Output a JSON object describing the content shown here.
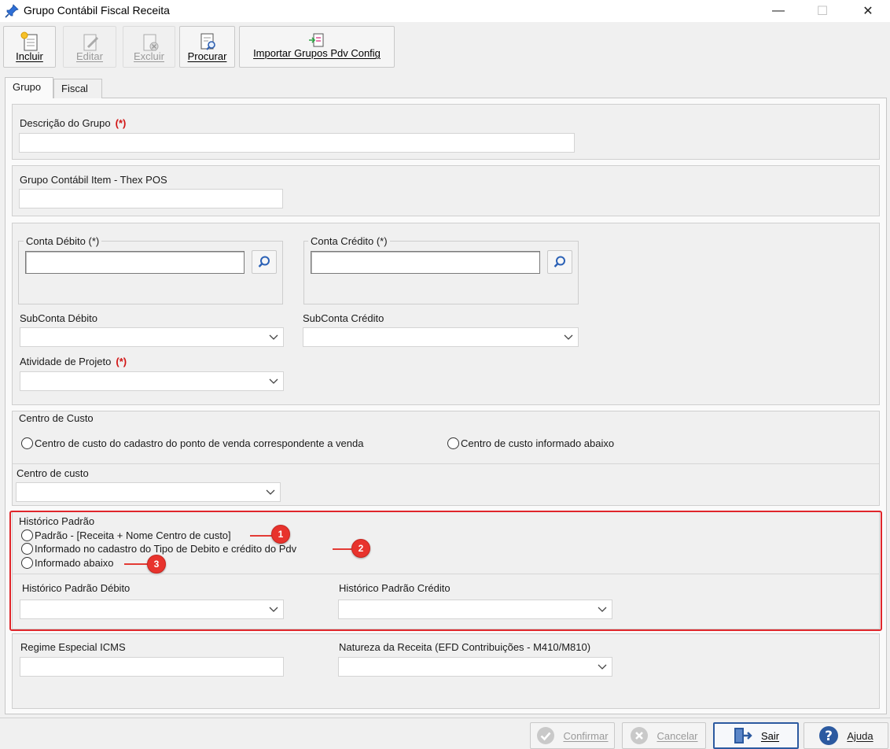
{
  "window": {
    "title": "Grupo Contábil Fiscal Receita",
    "controls": {
      "minimize": "—",
      "maximize": "☐",
      "close": "✕"
    }
  },
  "toolbar": {
    "buttons": [
      {
        "label": "Incluir",
        "icon": "new-document-icon",
        "enabled": true
      },
      {
        "label": "Editar",
        "icon": "edit-document-icon",
        "enabled": false
      },
      {
        "label": "Excluir",
        "icon": "delete-document-icon",
        "enabled": false
      },
      {
        "label": "Procurar",
        "icon": "search-document-icon",
        "enabled": true
      },
      {
        "label": "Importar Grupos Pdv Config",
        "icon": "import-document-icon",
        "enabled": true
      }
    ]
  },
  "tabs": [
    {
      "label": "Grupo",
      "active": true
    },
    {
      "label": "Fiscal",
      "active": false
    }
  ],
  "form": {
    "descricao_grupo": {
      "label": "Descrição do Grupo",
      "required_mark": "(*)",
      "value": ""
    },
    "grupo_contabil_item": {
      "label": "Grupo Contábil Item - Thex POS",
      "value": ""
    },
    "conta_debito": {
      "label": "Conta Débito (*)",
      "value": ""
    },
    "conta_credito": {
      "label": "Conta Crédito (*)",
      "value": ""
    },
    "subconta_debito": {
      "label": "SubConta Débito",
      "value": ""
    },
    "subconta_credito": {
      "label": "SubConta Crédito",
      "value": ""
    },
    "atividade_projeto": {
      "label": "Atividade de Projeto",
      "required_mark": "(*)",
      "value": ""
    },
    "centro_custo_group": {
      "title": "Centro de Custo",
      "options": [
        "Centro de custo do cadastro do ponto de venda correspondente a venda",
        "Centro de custo informado abaixo"
      ]
    },
    "centro_custo": {
      "label": "Centro de custo",
      "value": ""
    },
    "historico_padrao": {
      "title": "Histórico Padrão",
      "options": [
        "Padrão - [Receita + Nome Centro de custo]",
        "Informado no cadastro do Tipo de Debito e crédito do Pdv",
        "Informado abaixo"
      ],
      "annotations": [
        "1",
        "2",
        "3"
      ],
      "highlight_color": "#e0262b"
    },
    "historico_debito": {
      "label": "Histórico Padrão Débito",
      "value": ""
    },
    "historico_credito": {
      "label": "Histórico Padrão Crédito",
      "value": ""
    },
    "regime_icms": {
      "label": "Regime Especial ICMS",
      "value": ""
    },
    "natureza_receita": {
      "label": "Natureza da Receita (EFD Contribuições - M410/M810)",
      "value": ""
    }
  },
  "footer": {
    "buttons": [
      {
        "label": "Confirmar",
        "icon": "check-circle-icon",
        "enabled": false
      },
      {
        "label": "Cancelar",
        "icon": "cancel-circle-icon",
        "enabled": false
      },
      {
        "label": "Sair",
        "icon": "exit-door-icon",
        "enabled": true
      },
      {
        "label": "Ajuda",
        "icon": "help-circle-icon",
        "enabled": true
      }
    ]
  },
  "colors": {
    "accent": "#2c5aa0",
    "required": "#d11414",
    "annotation": "#e8332d"
  }
}
